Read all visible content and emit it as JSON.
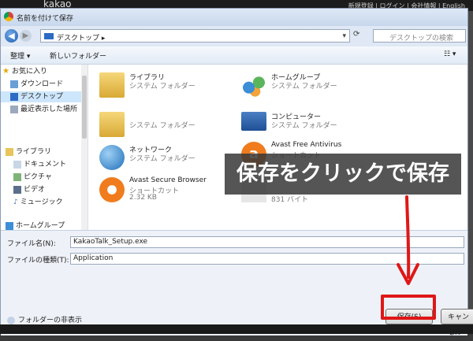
{
  "background": {
    "brand": "kakao",
    "links": "新規登録 | ログイン | 会社情報 | English"
  },
  "dialog": {
    "title": "名前を付けて保存",
    "address": "デスクトップ",
    "address_sep": "▸",
    "search_placeholder": "デスクトップの検索",
    "toolbar": {
      "organize": "整理 ▾",
      "new_folder": "新しいフォルダー",
      "view": "☷ ▾"
    },
    "sidebar": {
      "favorites": "お気に入り",
      "downloads": "ダウンロード",
      "desktop": "デスクトップ",
      "recent": "最近表示した場所",
      "libraries": "ライブラリ",
      "documents": "ドキュメント",
      "pictures": "ピクチャ",
      "videos": "ビデオ",
      "music": "ミュージック",
      "homegroup": "ホームグループ"
    },
    "files": [
      {
        "name": "ライブラリ",
        "sub1": "システム フォルダー",
        "sub2": ""
      },
      {
        "name": "ホームグループ",
        "sub1": "システム フォルダー",
        "sub2": ""
      },
      {
        "name": "",
        "sub1": "システム フォルダー",
        "sub2": ""
      },
      {
        "name": "コンピューター",
        "sub1": "システム フォルダー",
        "sub2": ""
      },
      {
        "name": "ネットワーク",
        "sub1": "システム フォルダー",
        "sub2": ""
      },
      {
        "name": "Avast Free Antivirus",
        "sub1": "ショートカット",
        "sub2": ""
      },
      {
        "name": "Avast Secure Browser",
        "sub1": "ショートカット",
        "sub2": "2.32 KB"
      },
      {
        "name": "",
        "sub1": "",
        "sub2": "831 バイト"
      }
    ],
    "filename_label": "ファイル名(N):",
    "filename_value": "KakaoTalk_Setup.exe",
    "filetype_label": "ファイルの種類(T):",
    "filetype_value": "Application",
    "hide_folders": "フォルダーの非表示",
    "save_button": "保存(S)",
    "cancel_button": "キャンセル"
  },
  "annotation": "保存をクリックで保存",
  "colors": {
    "highlight": "#e01717",
    "selection": "#cde6fb"
  }
}
